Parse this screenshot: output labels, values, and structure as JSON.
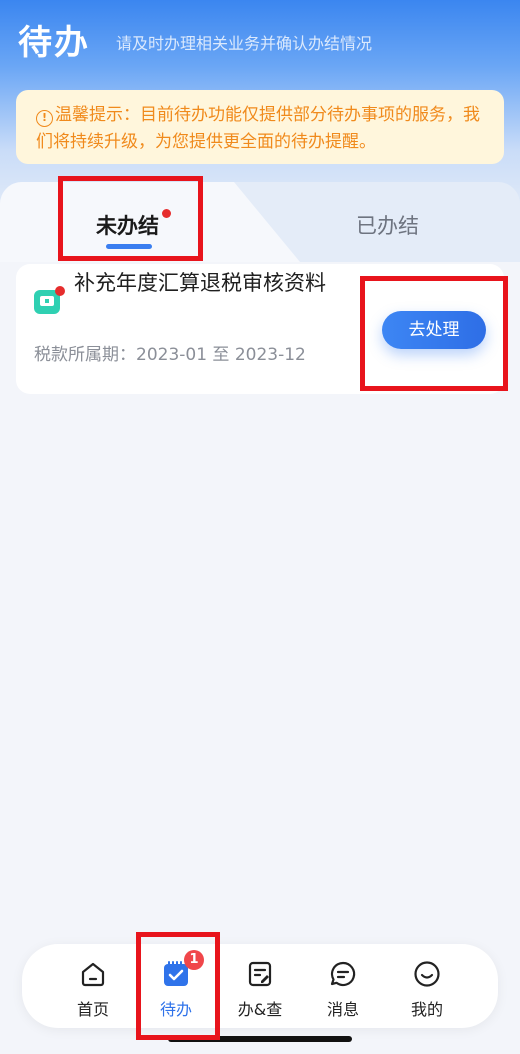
{
  "header": {
    "title": "待办",
    "subtitle": "请及时办理相关业务并确认办结情况"
  },
  "notice": {
    "icon": "info-icon",
    "icon_glyph": "!",
    "text": "温馨提示：目前待办功能仅提供部分待办事项的服务，我们将持续升级，为您提供更全面的待办提醒。"
  },
  "tabs": [
    {
      "label": "未办结",
      "active": true,
      "has_red_dot": true
    },
    {
      "label": "已办结",
      "active": false
    }
  ],
  "tasks": [
    {
      "icon": "tax-document-icon",
      "title": "补充年度汇算退税审核资料",
      "period": "税款所属期：2023-01 至 2023-12",
      "action_label": "去处理"
    }
  ],
  "bottom_nav": [
    {
      "label": "首页",
      "icon": "home-icon",
      "active": false
    },
    {
      "label": "待办",
      "icon": "todo-calendar-icon",
      "active": true,
      "badge": "1"
    },
    {
      "label": "办&查",
      "icon": "handle-query-icon",
      "active": false
    },
    {
      "label": "消息",
      "icon": "message-icon",
      "active": false
    },
    {
      "label": "我的",
      "icon": "profile-smile-icon",
      "active": false
    }
  ],
  "colors": {
    "primary": "#3a7ef0",
    "notice_text": "#f08a1c",
    "notice_bg": "#fff6dc",
    "badge_red": "#f0464a",
    "annotation_red": "#e8141c"
  }
}
